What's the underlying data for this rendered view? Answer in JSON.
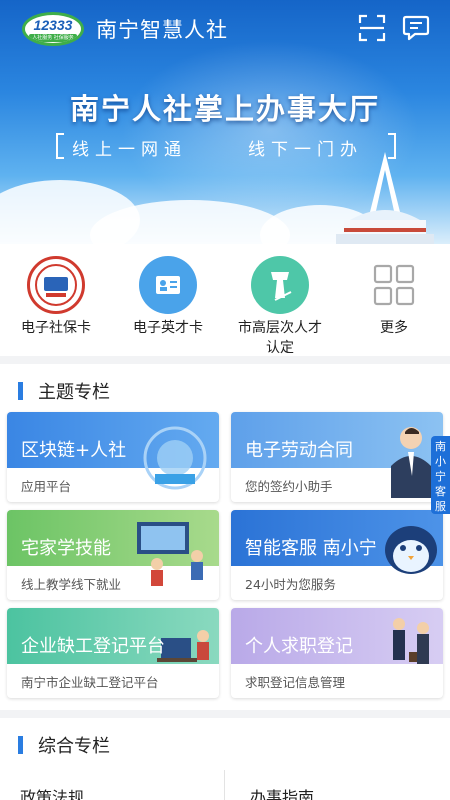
{
  "header": {
    "logo_text": "12333",
    "logo_sub": "人社服务 社保服务",
    "title": "南宁智慧人社",
    "banner_title": "南宁人社掌上办事大厅",
    "slogan_left": "线上一网通",
    "slogan_right": "线下一门办"
  },
  "quick_actions": [
    {
      "label": "电子社保卡",
      "icon": "social-security-card-icon"
    },
    {
      "label": "电子英才卡",
      "icon": "talent-card-icon"
    },
    {
      "label": "市高层次人才认定",
      "icon": "certification-pen-icon"
    },
    {
      "label": "更多",
      "icon": "grid-more-icon"
    }
  ],
  "topic_section": {
    "title": "主题专栏",
    "cards": [
      {
        "title": "区块链+人社",
        "subtitle": "应用平台"
      },
      {
        "title": "电子劳动合同",
        "subtitle": "您的签约小助手"
      },
      {
        "title": "宅家学技能",
        "subtitle": "线上教学线下就业"
      },
      {
        "title": "智能客服 南小宁",
        "subtitle": "24小时为您服务"
      },
      {
        "title": "企业缺工登记平台",
        "subtitle": "南宁市企业缺工登记平台"
      },
      {
        "title": "个人求职登记",
        "subtitle": "求职登记信息管理"
      }
    ]
  },
  "side_tab": "南小宁客服",
  "general_section": {
    "title": "综合专栏",
    "items": [
      "政策法规",
      "办事指南"
    ]
  },
  "colors": {
    "primary": "#2a7de1",
    "card_blue": "#3f8fe6",
    "card_green": "#7cc86e",
    "side_tab": "#1d6fd8"
  }
}
